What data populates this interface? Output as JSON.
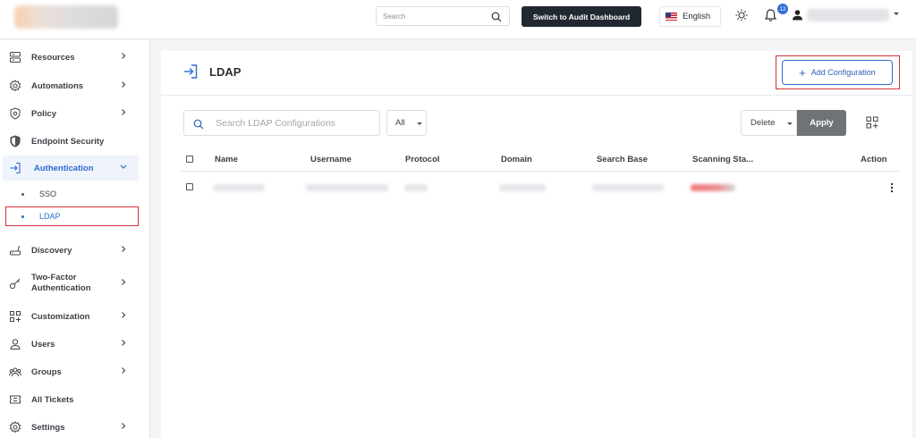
{
  "header": {
    "search_placeholder": "Search",
    "audit_button": "Switch to Audit Dashboard",
    "language": "English",
    "notification_count": "12"
  },
  "sidebar": {
    "items": [
      {
        "label": "Resources",
        "icon": "server-icon"
      },
      {
        "label": "Automations",
        "icon": "gear-icon"
      },
      {
        "label": "Policy",
        "icon": "policy-shield-icon"
      },
      {
        "label": "Endpoint Security",
        "icon": "shield-icon"
      },
      {
        "label": "Authentication",
        "icon": "sign-in-icon"
      },
      {
        "label": "Discovery",
        "icon": "router-icon"
      },
      {
        "label": "Two-Factor Authentication",
        "icon": "key-icon"
      },
      {
        "label": "Customization",
        "icon": "customize-icon"
      },
      {
        "label": "Users",
        "icon": "user-icon"
      },
      {
        "label": "Groups",
        "icon": "group-icon"
      },
      {
        "label": "All Tickets",
        "icon": "ticket-icon"
      },
      {
        "label": "Settings",
        "icon": "settings-icon"
      }
    ],
    "subitems": [
      {
        "label": "SSO"
      },
      {
        "label": "LDAP"
      }
    ]
  },
  "main": {
    "title": "LDAP",
    "add_button": "Add Configuration",
    "search_placeholder": "Search LDAP Configurations",
    "filter_value": "All",
    "bulk_action": "Delete",
    "apply_button": "Apply",
    "columns": [
      "Name",
      "Username",
      "Protocol",
      "Domain",
      "Search Base",
      "Scanning Sta...",
      "Action"
    ]
  },
  "colors": {
    "accent": "#2d6bcf",
    "highlight_outline": "#d43138",
    "dark_button": "#222831",
    "apply_button": "#6f7378"
  }
}
